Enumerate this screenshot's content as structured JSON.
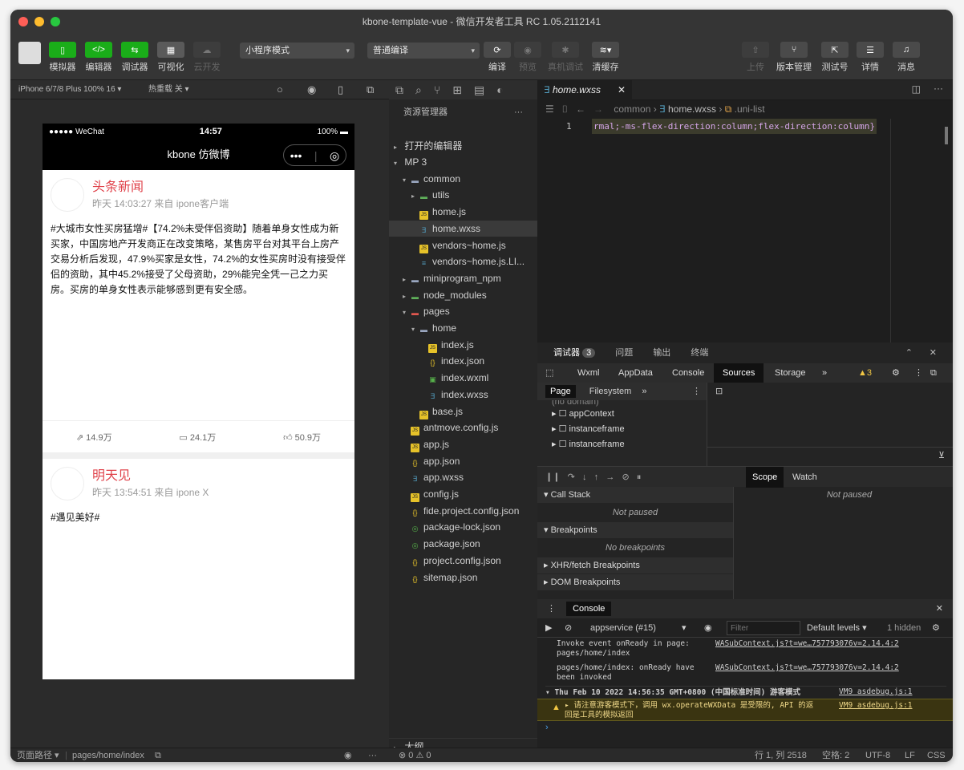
{
  "window": {
    "title": "kbone-template-vue - 微信开发者工具 RC 1.05.2112141"
  },
  "toolbar": {
    "simulator": "模拟器",
    "editor": "编辑器",
    "debugger": "调试器",
    "visual": "可视化",
    "cloud": "云开发",
    "mode_select": "小程序模式",
    "compile_select": "普通编译",
    "compile": "编译",
    "preview": "预览",
    "real_debug": "真机调试",
    "clear_cache": "清缓存",
    "upload": "上传",
    "version": "版本管理",
    "test": "测试号",
    "details": "详情",
    "messages": "消息"
  },
  "simbar": {
    "device": "iPhone 6/7/8 Plus 100% 16 ▾",
    "hotreload": "热重载 关 ▾"
  },
  "phone": {
    "carrier": "●●●●● WeChat",
    "time": "14:57",
    "battery": "100%",
    "nav_title": "kbone 仿微博",
    "posts": [
      {
        "author": "头条新闻",
        "meta": "昨天 14:03:27 来自 ipone客户端",
        "text": "#大城市女性买房猛增#【74.2%未受伴侣资助】随着单身女性成为新买家，中国房地产开发商正在改变策略，某售房平台对其平台上房产交易分析后发现，47.9%买家是女性，74.2%的女性买房时没有接受伴侣的资助，其中45.2%接受了父母资助，29%能完全凭一己之力买房。买房的单身女性表示能够感到更有安全感。",
        "shares": "14.9万",
        "comments": "24.1万",
        "likes": "50.9万"
      },
      {
        "author": "明天见",
        "meta": "昨天 13:54:51 来自 ipone X",
        "text": "#遇见美好#"
      }
    ]
  },
  "statusline": {
    "path_label": "页面路径 ▾",
    "path": "pages/home/index",
    "errors": "⊗ 0 ⚠ 0",
    "position": "行 1, 列 2518",
    "spaces": "空格: 2",
    "encoding": "UTF-8",
    "eol": "LF",
    "lang": "CSS"
  },
  "explorer": {
    "title": "资源管理器",
    "open_editors": "打开的编辑器",
    "outline": "大纲",
    "items": [
      {
        "label": "MP 3",
        "level": 0,
        "chev": "▾",
        "type": "none"
      },
      {
        "label": "common",
        "level": 1,
        "chev": "▾",
        "type": "folder"
      },
      {
        "label": "utils",
        "level": 2,
        "chev": "▸",
        "type": "folder-green"
      },
      {
        "label": "home.js",
        "level": 2,
        "chev": "",
        "type": "js"
      },
      {
        "label": "home.wxss",
        "level": 2,
        "chev": "",
        "type": "wxss",
        "selected": true
      },
      {
        "label": "vendors~home.js",
        "level": 2,
        "chev": "",
        "type": "js"
      },
      {
        "label": "vendors~home.js.LI...",
        "level": 2,
        "chev": "",
        "type": "txt"
      },
      {
        "label": "miniprogram_npm",
        "level": 1,
        "chev": "▸",
        "type": "folder"
      },
      {
        "label": "node_modules",
        "level": 1,
        "chev": "▸",
        "type": "folder-green"
      },
      {
        "label": "pages",
        "level": 1,
        "chev": "▾",
        "type": "folder-red"
      },
      {
        "label": "home",
        "level": 2,
        "chev": "▾",
        "type": "folder"
      },
      {
        "label": "index.js",
        "level": 3,
        "chev": "",
        "type": "js"
      },
      {
        "label": "index.json",
        "level": 3,
        "chev": "",
        "type": "json"
      },
      {
        "label": "index.wxml",
        "level": 3,
        "chev": "",
        "type": "wxml"
      },
      {
        "label": "index.wxss",
        "level": 3,
        "chev": "",
        "type": "wxss"
      },
      {
        "label": "base.js",
        "level": 2,
        "chev": "",
        "type": "js"
      },
      {
        "label": "antmove.config.js",
        "level": 1,
        "chev": "",
        "type": "js"
      },
      {
        "label": "app.js",
        "level": 1,
        "chev": "",
        "type": "js"
      },
      {
        "label": "app.json",
        "level": 1,
        "chev": "",
        "type": "json"
      },
      {
        "label": "app.wxss",
        "level": 1,
        "chev": "",
        "type": "wxss"
      },
      {
        "label": "config.js",
        "level": 1,
        "chev": "",
        "type": "js"
      },
      {
        "label": "fide.project.config.json",
        "level": 1,
        "chev": "",
        "type": "json"
      },
      {
        "label": "package-lock.json",
        "level": 1,
        "chev": "",
        "type": "npm"
      },
      {
        "label": "package.json",
        "level": 1,
        "chev": "",
        "type": "npm"
      },
      {
        "label": "project.config.json",
        "level": 1,
        "chev": "",
        "type": "json"
      },
      {
        "label": "sitemap.json",
        "level": 1,
        "chev": "",
        "type": "json"
      }
    ]
  },
  "editor": {
    "tab": "home.wxss",
    "crumb_common": "common",
    "crumb_file": "home.wxss",
    "crumb_symbol": ".uni-list",
    "line_no": "1",
    "code": "rmal;-ms-flex-direction:column;flex-direction:column}"
  },
  "devtools": {
    "tab_debugger": "调试器",
    "badge": "3",
    "tab_issues": "问题",
    "tab_output": "输出",
    "tab_terminal": "终端",
    "panels": [
      "Wxml",
      "AppData",
      "Console",
      "Sources",
      "Storage"
    ],
    "warn_count": "3",
    "sub_page": "Page",
    "sub_fs": "Filesystem",
    "tree": [
      "(no domain)",
      "appContext",
      "instanceframe",
      "instanceframe"
    ],
    "scope": "Scope",
    "watch": "Watch",
    "not_paused": "Not paused",
    "call_stack": "Call Stack",
    "call_stack_msg": "Not paused",
    "breakpoints": "Breakpoints",
    "breakpoints_msg": "No breakpoints",
    "xhr": "XHR/fetch Breakpoints",
    "dom": "DOM Breakpoints",
    "console_tab": "Console",
    "context": "appservice (#15)",
    "filter_placeholder": "Filter",
    "levels": "Default levels ▾",
    "hidden": "1 hidden",
    "logs": [
      {
        "text1": "Invoke event onReady in page:",
        "text2": "pages/home/index",
        "link": "WASubContext.js?t=we…757793076v=2.14.4:2"
      },
      {
        "text1": "pages/home/index: onReady have",
        "text2": "been invoked",
        "link": "WASubContext.js?t=we…757793076v=2.14.4:2"
      }
    ],
    "group": "▾ Thu Feb 10 2022 14:56:35 GMT+0800 (中国标准时间) 游客模式",
    "group_link": "VM9 asdebug.js:1",
    "warn1": "▸ 请注意游客模式下，调用 wx.operateWXData 是受限的, API 的返",
    "warn2": "回是工具的模拟返回",
    "warn_link": "VM9 asdebug.js:1",
    "prompt": "›"
  }
}
